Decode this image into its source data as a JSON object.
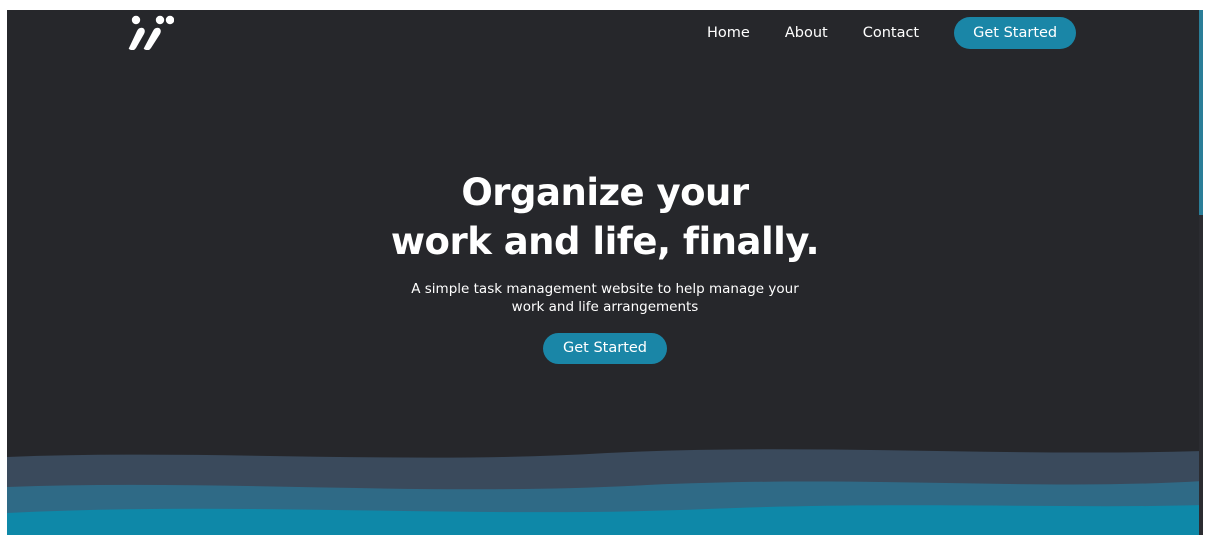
{
  "nav": {
    "home": "Home",
    "about": "About",
    "contact": "Contact",
    "cta": "Get Started"
  },
  "hero": {
    "title_line1": "Organize your",
    "title_line2": "work and life, finally.",
    "subtitle_line1": "A simple task management website to help manage your",
    "subtitle_line2": "work and life arrangements",
    "cta": "Get Started"
  },
  "logo": {
    "icon": "brand-slashes-logo"
  },
  "colors": {
    "background": "#26272b",
    "accent": "#1a86a7",
    "text": "#ffffff",
    "wave_dark": "#3a4a5c",
    "wave_mid": "#2f6a86",
    "wave_light": "#0e88a8"
  }
}
